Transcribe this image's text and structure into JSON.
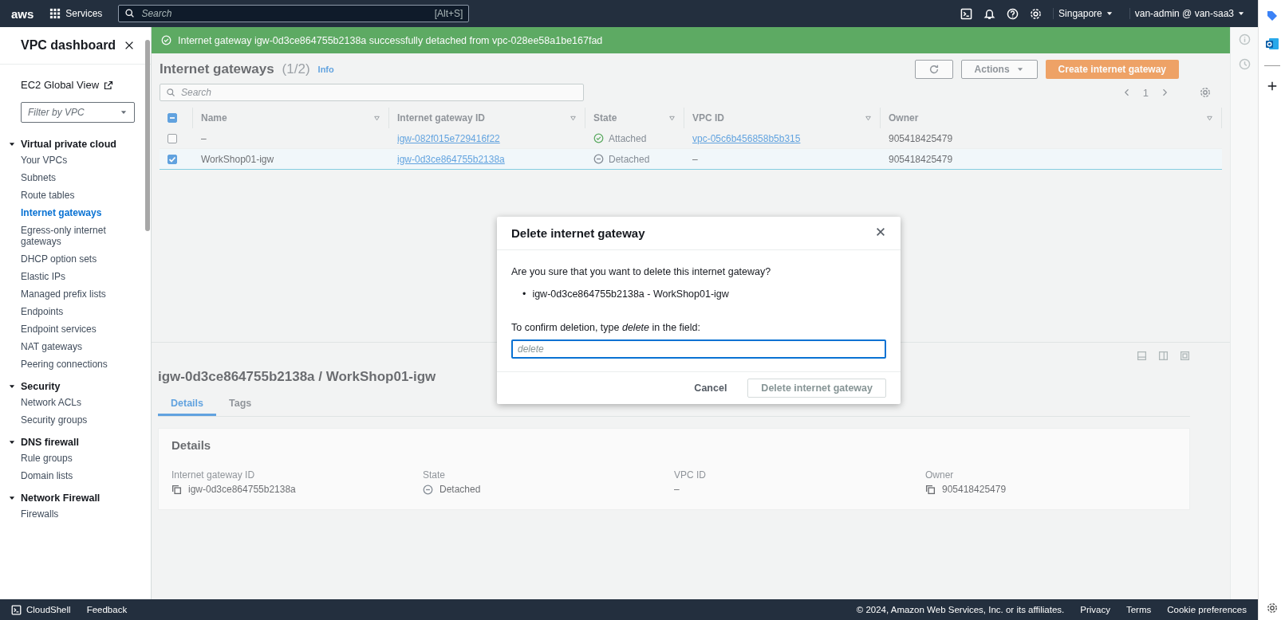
{
  "top_bar": {
    "logo": "aws",
    "services": "Services",
    "search": {
      "placeholder": "Search",
      "shortcut": "[Alt+S]"
    },
    "region": "Singapore",
    "account": "van-admin @ van-saa3"
  },
  "sidebar": {
    "title": "VPC dashboard",
    "global_view": "EC2 Global View",
    "filter": {
      "placeholder": "Filter by VPC"
    },
    "sections": [
      {
        "label": "Virtual private cloud",
        "expanded": true,
        "items": [
          {
            "label": "Your VPCs",
            "selected": false
          },
          {
            "label": "Subnets",
            "selected": false
          },
          {
            "label": "Route tables",
            "selected": false
          },
          {
            "label": "Internet gateways",
            "selected": true
          },
          {
            "label": "Egress-only internet gateways",
            "selected": false
          },
          {
            "label": "DHCP option sets",
            "selected": false
          },
          {
            "label": "Elastic IPs",
            "selected": false
          },
          {
            "label": "Managed prefix lists",
            "selected": false
          },
          {
            "label": "Endpoints",
            "selected": false
          },
          {
            "label": "Endpoint services",
            "selected": false
          },
          {
            "label": "NAT gateways",
            "selected": false
          },
          {
            "label": "Peering connections",
            "selected": false
          }
        ]
      },
      {
        "label": "Security",
        "expanded": true,
        "items": [
          {
            "label": "Network ACLs",
            "selected": false
          },
          {
            "label": "Security groups",
            "selected": false
          }
        ]
      },
      {
        "label": "DNS firewall",
        "expanded": true,
        "items": [
          {
            "label": "Rule groups",
            "selected": false
          },
          {
            "label": "Domain lists",
            "selected": false
          }
        ]
      },
      {
        "label": "Network Firewall",
        "expanded": true,
        "items": [
          {
            "label": "Firewalls",
            "selected": false
          }
        ]
      }
    ]
  },
  "banner": {
    "message": "Internet gateway igw-0d3ce864755b2138a successfully detached from vpc-028ee58a1be167fad"
  },
  "table": {
    "title": "Internet gateways",
    "count": "(1/2)",
    "info": "Info",
    "actions": "Actions",
    "create": "Create internet gateway",
    "search": {
      "placeholder": "Search"
    },
    "page": "1",
    "select_all_partial": true,
    "columns": [
      "Name",
      "Internet gateway ID",
      "State",
      "VPC ID",
      "Owner"
    ],
    "rows": [
      {
        "selected": false,
        "name": "–",
        "gateway_id": "igw-082f015e729416f22",
        "state": {
          "kind": "attached",
          "label": "Attached"
        },
        "vpc_id": {
          "text": "vpc-05c6b456858b5b315",
          "link": true
        },
        "owner": "905418425479"
      },
      {
        "selected": true,
        "name": "WorkShop01-igw",
        "gateway_id": "igw-0d3ce864755b2138a",
        "state": {
          "kind": "detached",
          "label": "Detached"
        },
        "vpc_id": {
          "text": "–",
          "link": false
        },
        "owner": "905418425479"
      }
    ]
  },
  "detail_panel": {
    "title": "igw-0d3ce864755b2138a / WorkShop01-igw",
    "tabs": [
      {
        "label": "Details",
        "selected": true
      },
      {
        "label": "Tags",
        "selected": false
      }
    ],
    "card_title": "Details",
    "fields": [
      {
        "label": "Internet gateway ID",
        "kind": "copy",
        "value": "igw-0d3ce864755b2138a"
      },
      {
        "label": "State",
        "kind": "status",
        "value": "Detached"
      },
      {
        "label": "VPC ID",
        "kind": "plain",
        "value": "–"
      },
      {
        "label": "Owner",
        "kind": "copy",
        "value": "905418425479"
      }
    ]
  },
  "dialog": {
    "title": "Delete internet gateway",
    "question": "Are you sure that you want to delete this internet gateway?",
    "items": [
      {
        "bullet": "•",
        "text": "igw-0d3ce864755b2138a - WorkShop01-igw"
      }
    ],
    "confirm_label": "To confirm deletion, type *delete* in the field:",
    "input": {
      "placeholder": "delete"
    },
    "cancel": "Cancel",
    "confirm": {
      "label": "Delete internet gateway",
      "disabled": true
    }
  },
  "footer": {
    "cloudshell": "CloudShell",
    "feedback": "Feedback",
    "copyright": "© 2024, Amazon Web Services, Inc. or its affiliates.",
    "links": [
      "Privacy",
      "Terms",
      "Cookie preferences"
    ]
  }
}
